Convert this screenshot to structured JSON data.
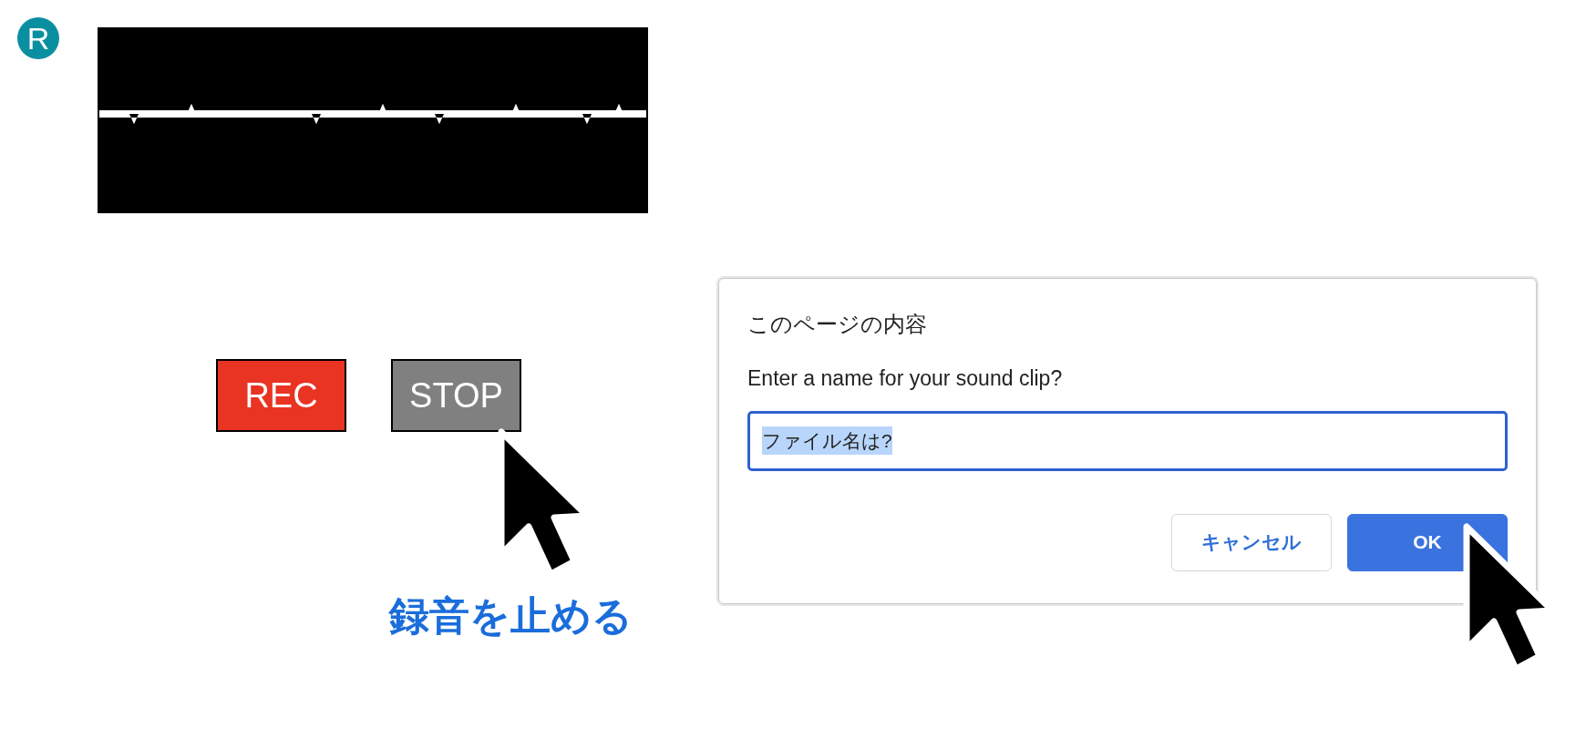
{
  "logo": {
    "letter": "R"
  },
  "controls": [
    {
      "label": "REC",
      "kind": "record"
    },
    {
      "label": "STOP",
      "kind": "stop"
    }
  ],
  "caption": "録音を止める",
  "dialog": {
    "title": "このページの内容",
    "message": "Enter a name for your sound clip?",
    "input": {
      "value": "ファイル名は?",
      "focused": true,
      "text_selected": true
    },
    "buttons": [
      {
        "label": "キャンセル",
        "kind": "secondary"
      },
      {
        "label": "OK",
        "kind": "primary"
      }
    ]
  }
}
